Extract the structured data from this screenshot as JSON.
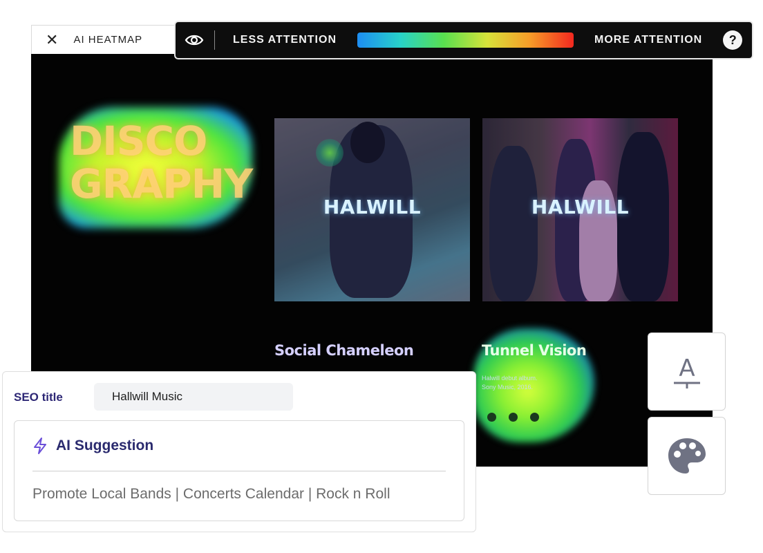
{
  "tab": {
    "label": "AI HEATMAP"
  },
  "legend": {
    "less_label": "LESS ATTENTION",
    "more_label": "MORE ATTENTION",
    "help_label": "?"
  },
  "canvas": {
    "discography": [
      "DISCO",
      "GRAPHY"
    ],
    "albums": [
      {
        "label": "HALWILL",
        "title": "Social Chameleon"
      },
      {
        "label": "HALWILL",
        "title": "Tunnel Vision",
        "subtitle_lines": [
          "Halwill debut album.",
          "Sony Music, 2016."
        ]
      }
    ]
  },
  "seo": {
    "label": "SEO title",
    "value": "Hallwill Music",
    "suggestion_title": "AI Suggestion",
    "suggestion_text": "Promote Local Bands | Concerts Calendar | Rock n Roll"
  },
  "tools": [
    {
      "icon": "text-style-icon",
      "glyph": "A"
    },
    {
      "icon": "palette-icon"
    }
  ],
  "colors": {
    "accent": "#2d2775",
    "legend_bg": "#0d0d0d",
    "suggestion_icon": "#6b4fd8"
  }
}
